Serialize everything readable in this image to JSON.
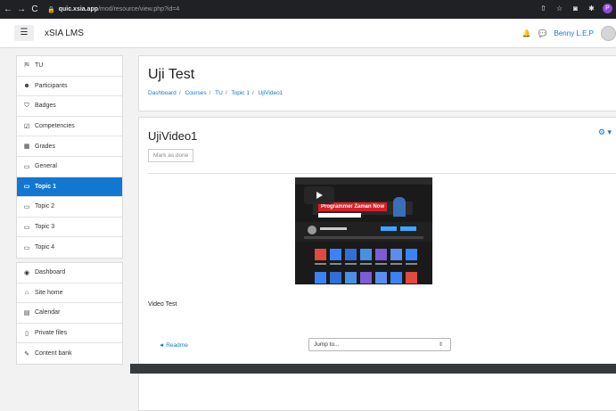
{
  "browser": {
    "nav": [
      "←",
      "→",
      "C"
    ],
    "url_host": "quic.xsia.app",
    "url_path": "/mod/resource/view.php?id=4",
    "profile_letter": "P"
  },
  "navbar": {
    "site_name": "xSIA LMS",
    "user_name": "Benny L.E.P"
  },
  "sidebar": {
    "top": [
      {
        "label": "TU",
        "icon": "graduation-cap-icon",
        "glyph": "⛿"
      },
      {
        "label": "Participants",
        "icon": "users-icon",
        "glyph": "☻"
      },
      {
        "label": "Badges",
        "icon": "shield-icon",
        "glyph": "⛉"
      },
      {
        "label": "Competencies",
        "icon": "check-square-icon",
        "glyph": "☑"
      },
      {
        "label": "Grades",
        "icon": "table-icon",
        "glyph": "▦"
      },
      {
        "label": "General",
        "icon": "folder-icon",
        "glyph": "▭"
      },
      {
        "label": "Topic 1",
        "icon": "folder-icon",
        "glyph": "▭",
        "active": true
      },
      {
        "label": "Topic 2",
        "icon": "folder-icon",
        "glyph": "▭"
      },
      {
        "label": "Topic 3",
        "icon": "folder-icon",
        "glyph": "▭"
      },
      {
        "label": "Topic 4",
        "icon": "folder-icon",
        "glyph": "▭"
      }
    ],
    "bottom": [
      {
        "label": "Dashboard",
        "icon": "dashboard-icon",
        "glyph": "◉"
      },
      {
        "label": "Site home",
        "icon": "home-icon",
        "glyph": "⌂"
      },
      {
        "label": "Calendar",
        "icon": "calendar-icon",
        "glyph": "▤"
      },
      {
        "label": "Private files",
        "icon": "file-icon",
        "glyph": "▯"
      },
      {
        "label": "Content bank",
        "icon": "pencil-icon",
        "glyph": "✎"
      }
    ]
  },
  "header": {
    "title": "Uji Test",
    "breadcrumb": [
      "Dashboard",
      "Courses",
      "TU",
      "Topic 1",
      "UjiVideo1"
    ]
  },
  "content": {
    "title": "UjiVideo1",
    "mark_done": "Mark as done",
    "video_banner": "Programmer Zaman Now",
    "caption": "Video Test",
    "prev_link": "◄ Readme",
    "jump_to": "Jump to..."
  },
  "colors": {
    "accent": "#1177d1",
    "browser_bg": "#202124",
    "footer_bg": "#373a3c"
  }
}
